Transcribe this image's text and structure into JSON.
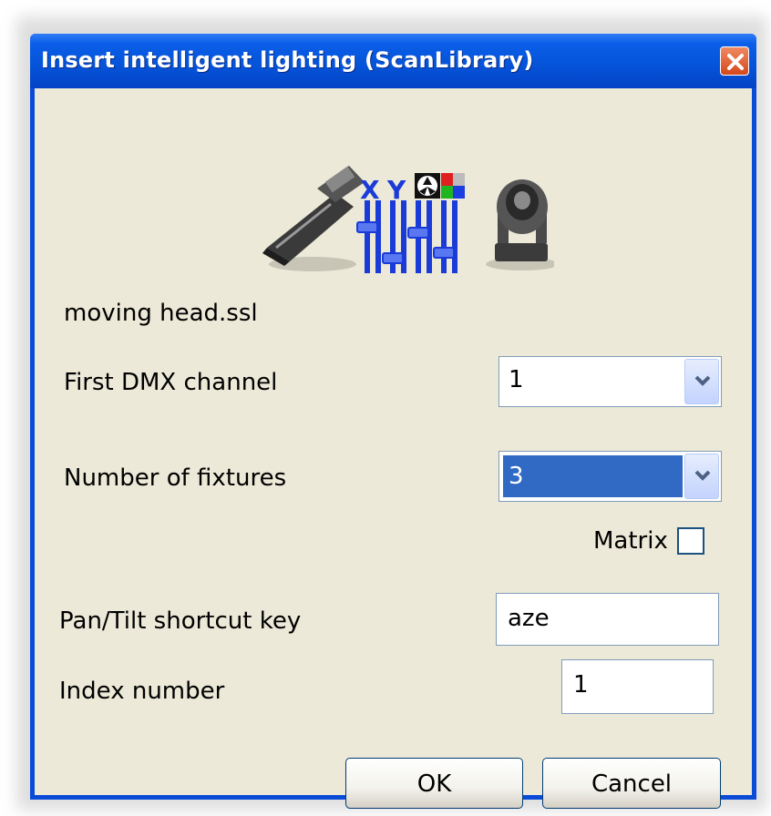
{
  "window": {
    "title": "Insert intelligent lighting (ScanLibrary)"
  },
  "form": {
    "filename": "moving head.ssl",
    "first_dmx_label": "First DMX channel",
    "first_dmx_value": "1",
    "fixtures_label": "Number of fixtures",
    "fixtures_value": "3",
    "matrix_label": "Matrix",
    "matrix_checked": false,
    "pan_tilt_label": "Pan/Tilt shortcut key",
    "pan_tilt_value": "aze",
    "index_label": "Index number",
    "index_value": "1"
  },
  "buttons": {
    "ok": "OK",
    "cancel": "Cancel"
  },
  "icons": {
    "close": "close-icon",
    "dropdown": "chevron-down-icon",
    "logo": "lighting-fixtures-icon"
  },
  "colors": {
    "title_bar": "#0553d8",
    "dialog_background": "#ece9d8",
    "selection": "#316ac5",
    "close_button": "#d4481c"
  }
}
